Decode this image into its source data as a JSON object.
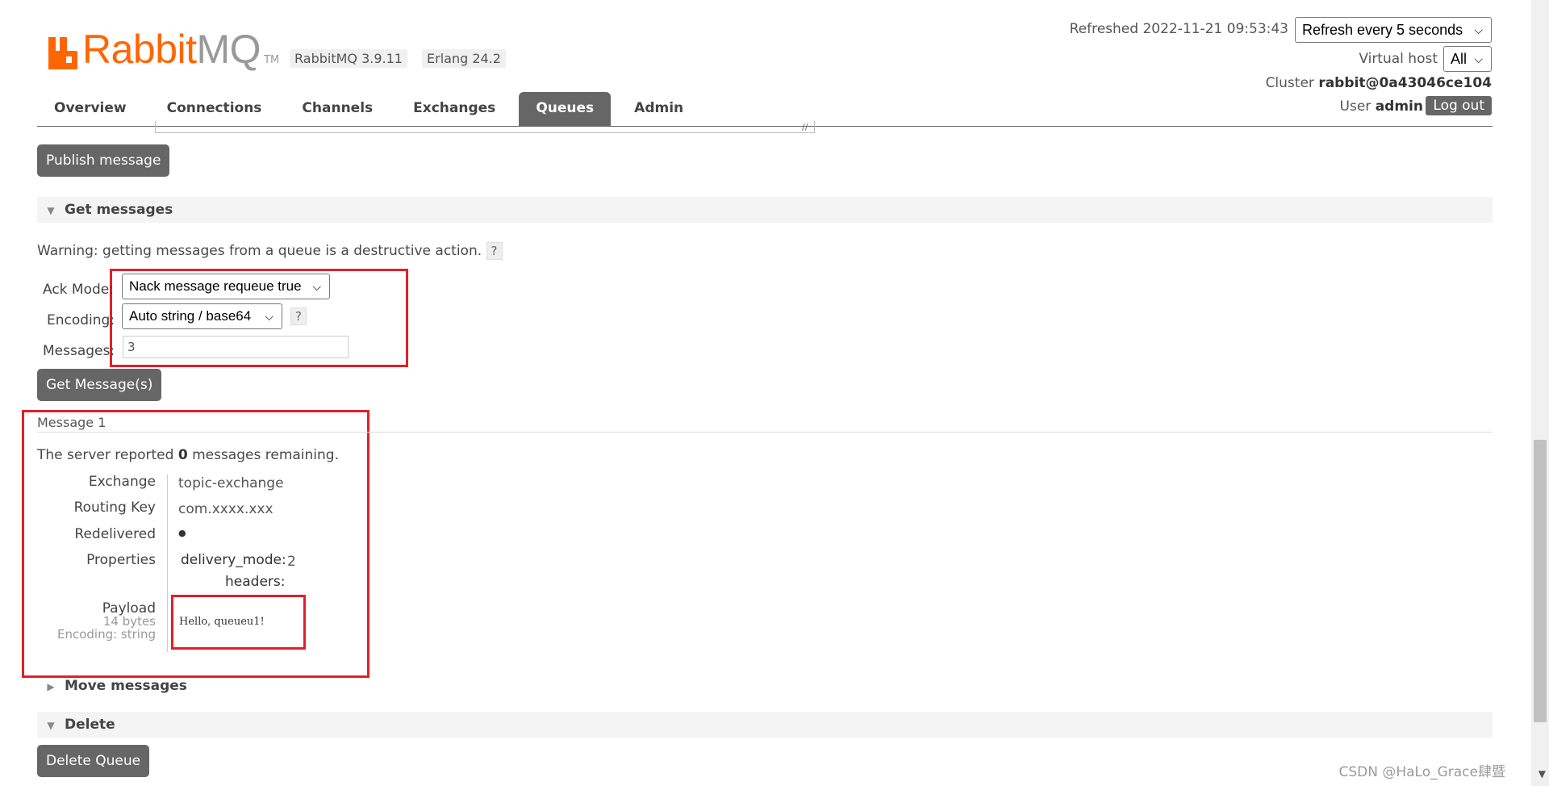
{
  "brand": {
    "name_part1": "Rabbit",
    "name_part2": "MQ",
    "tm": "TM"
  },
  "versions": {
    "rabbitmq": "RabbitMQ 3.9.11",
    "erlang": "Erlang 24.2"
  },
  "header": {
    "refreshed": "Refreshed 2022-11-21 09:53:43",
    "refresh_select": "Refresh every 5 seconds",
    "vhost_label": "Virtual host",
    "vhost_value": "All",
    "cluster_label": "Cluster",
    "cluster_value": "rabbit@0a43046ce104",
    "user_label": "User",
    "user_value": "admin",
    "logout": "Log out"
  },
  "tabs": [
    {
      "label": "Overview",
      "active": false
    },
    {
      "label": "Connections",
      "active": false
    },
    {
      "label": "Channels",
      "active": false
    },
    {
      "label": "Exchanges",
      "active": false
    },
    {
      "label": "Queues",
      "active": true
    },
    {
      "label": "Admin",
      "active": false
    }
  ],
  "publish": {
    "button": "Publish message"
  },
  "get_messages": {
    "title": "Get messages",
    "warning": "Warning: getting messages from a queue is a destructive action.",
    "help": "?",
    "ack_mode_label": "Ack Mode:",
    "ack_mode_value": "Nack message requeue true",
    "encoding_label": "Encoding:",
    "encoding_value": "Auto string / base64",
    "messages_label": "Messages:",
    "messages_value": "3",
    "button": "Get Message(s)"
  },
  "message": {
    "header": "Message 1",
    "server_reported_pre": "The server reported",
    "remaining_count": "0",
    "server_reported_post": "messages remaining.",
    "exchange_label": "Exchange",
    "exchange_value": "topic-exchange",
    "routing_key_label": "Routing Key",
    "routing_key_value": "com.xxxx.xxx",
    "redelivered_label": "Redelivered",
    "redelivered_value": "●",
    "properties_label": "Properties",
    "delivery_mode_label": "delivery_mode:",
    "delivery_mode_value": "2",
    "headers_label": "headers:",
    "payload_label": "Payload",
    "payload_size": "14 bytes",
    "payload_encoding": "Encoding: string",
    "payload_value": "Hello, queueu1!"
  },
  "move_messages": {
    "title": "Move messages"
  },
  "delete": {
    "title": "Delete",
    "button": "Delete Queue"
  },
  "watermark": "CSDN @HaLo_Grace肆暨"
}
